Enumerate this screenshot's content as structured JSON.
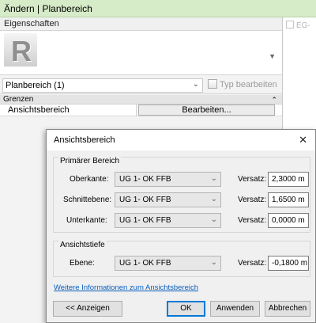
{
  "window_title": "Ändern | Planbereich",
  "properties": {
    "header": "Eigenschaften",
    "type_thumb_letter": "R",
    "instance_select": "Planbereich (1)",
    "edit_type_label": "Typ bearbeiten",
    "group_label": "Grenzen",
    "param_name": "Ansichtsbereich",
    "param_button": "Bearbeiten..."
  },
  "right_strip": {
    "label": "EG-"
  },
  "dialog": {
    "title": "Ansichtsbereich",
    "primary_group": "Primärer Bereich",
    "depth_group": "Ansichtstiefe",
    "offset_label": "Versatz:",
    "rows": [
      {
        "label": "Oberkante:",
        "level": "UG 1- OK FFB",
        "offset": "2,3000 m"
      },
      {
        "label": "Schnittebene:",
        "level": "UG 1- OK FFB",
        "offset": "1,6500 m"
      },
      {
        "label": "Unterkante:",
        "level": "UG 1- OK FFB",
        "offset": "0,0000 m"
      }
    ],
    "depth_row": {
      "label": "Ebene:",
      "level": "UG 1- OK FFB",
      "offset": "-0,1800 m"
    },
    "info_link": "Weitere Informationen zum Ansichtsbereich",
    "buttons": {
      "preview": "<< Anzeigen",
      "ok": "OK",
      "apply": "Anwenden",
      "cancel": "Abbrechen"
    }
  }
}
